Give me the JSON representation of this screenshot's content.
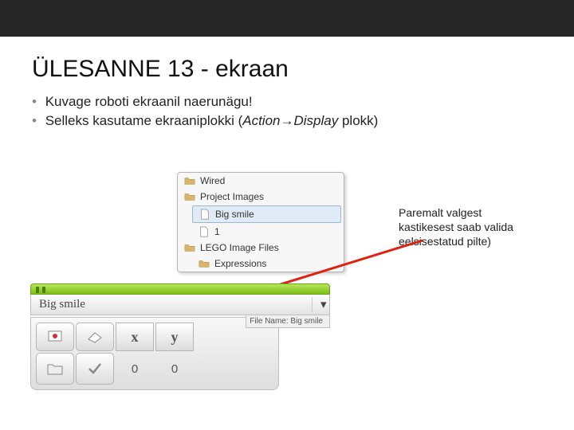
{
  "title": "ÜLESANNE 13 - ekraan",
  "bullets": {
    "b1": "Kuvage roboti ekraanil naerunägu!",
    "b2_a": "Selleks kasutame ekraaniplokki (",
    "b2_action": "Action",
    "b2_arrow": "→",
    "b2_display": "Display",
    "b2_b": " plokk)"
  },
  "dropdown": {
    "items": [
      {
        "label": "Wired",
        "icon": "folder"
      },
      {
        "label": "Project Images",
        "icon": "folder"
      },
      {
        "label": "Big smile",
        "icon": "file",
        "selected": true
      },
      {
        "label": "1",
        "icon": "file"
      },
      {
        "label": "LEGO Image Files",
        "icon": "folder"
      },
      {
        "label": "Expressions",
        "icon": "folder"
      }
    ]
  },
  "side_note": "Paremalt valgest kastikesest saab valida eelsisestatud pilte)",
  "field_label": "Big smile",
  "file_name_tag": "File Name: Big smile",
  "controls": {
    "x_label": "x",
    "y_label": "y",
    "x_val": "0",
    "y_val": "0"
  }
}
